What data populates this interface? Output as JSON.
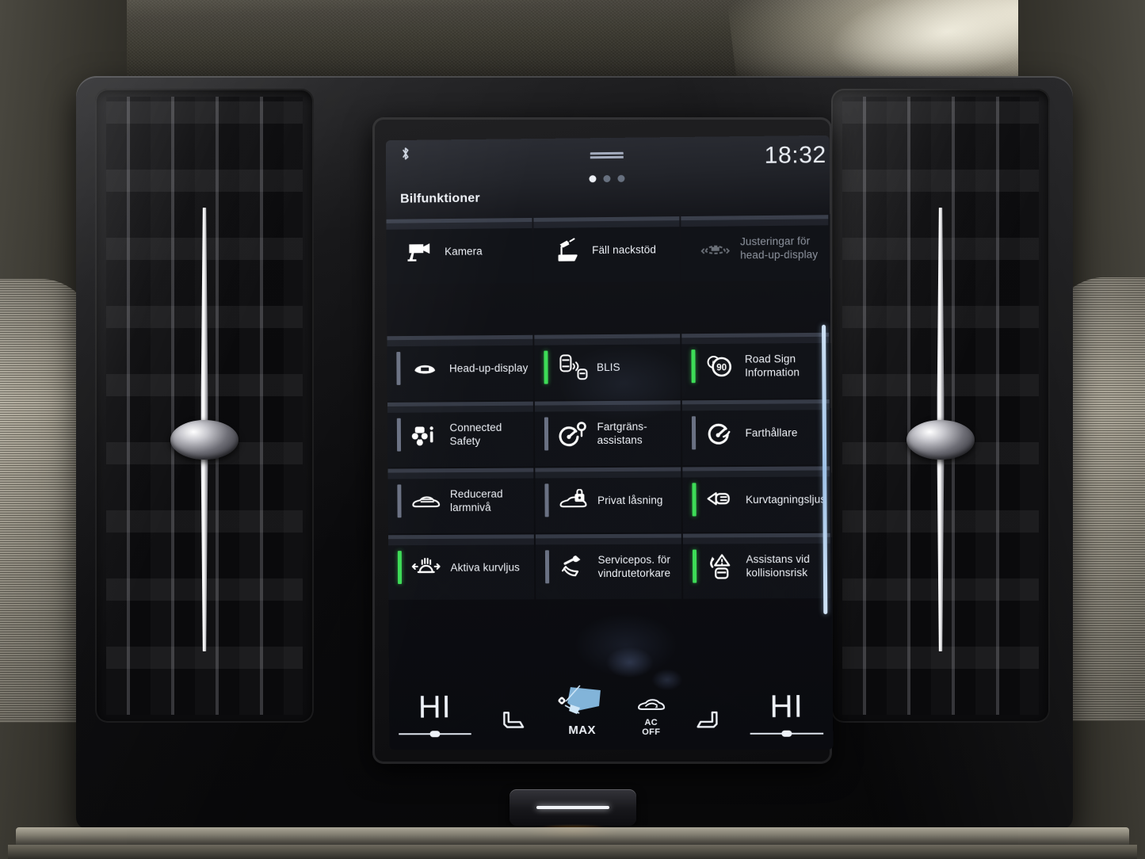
{
  "statusbar": {
    "bluetooth_icon": "bluetooth-icon",
    "time": "18:32",
    "page_dots": 3,
    "active_dot_index": 0
  },
  "page": {
    "title": "Bilfunktioner"
  },
  "colors": {
    "status_on": "#3ddc57",
    "status_off": "#6a7183",
    "scrollbar": "#bcd6ef",
    "text": "#eef1f7",
    "text_dim": "#8e949f",
    "climate_accent": "#7fb8e8"
  },
  "shortcut_row": [
    {
      "label": "Kamera",
      "icon": "camera-icon",
      "enabled": true,
      "has_status": false
    },
    {
      "label": "Fäll nackstöd",
      "icon": "fold-headrest-icon",
      "enabled": true,
      "has_status": false
    },
    {
      "label": "Justeringar för head-up-display",
      "icon": "head-up-display-adjust-icon",
      "enabled": false,
      "has_status": false
    }
  ],
  "function_tiles": [
    [
      {
        "label": "Head-up-display",
        "icon": "head-up-display-icon",
        "status": "off",
        "has_status": true
      },
      {
        "label": "BLIS",
        "icon": "blind-spot-icon",
        "status": "on",
        "has_status": true
      },
      {
        "label": "Road Sign Information",
        "icon": "road-sign-icon",
        "status": "on",
        "has_status": true
      }
    ],
    [
      {
        "label": "Connected Safety",
        "icon": "connected-safety-icon",
        "status": "off",
        "has_status": true
      },
      {
        "label": "Fartgräns-assistans",
        "icon": "speed-limiter-icon",
        "status": "off",
        "has_status": true
      },
      {
        "label": "Farthållare",
        "icon": "cruise-control-icon",
        "status": "off",
        "has_status": true
      }
    ],
    [
      {
        "label": "Reducerad larmnivå",
        "icon": "reduced-alarm-icon",
        "status": "off",
        "has_status": true
      },
      {
        "label": "Privat låsning",
        "icon": "private-locking-icon",
        "status": "off",
        "has_status": true
      },
      {
        "label": "Kurvtagningsljus",
        "icon": "cornering-light-icon",
        "status": "on",
        "has_status": true
      }
    ],
    [
      {
        "label": "Aktiva kurvljus",
        "icon": "active-bending-light-icon",
        "status": "on",
        "has_status": true
      },
      {
        "label": "Servicepos. för vindrutetorkare",
        "icon": "wiper-service-icon",
        "status": "off",
        "has_status": true
      },
      {
        "label": "Assistans vid kollisionsrisk",
        "icon": "collision-assist-icon",
        "status": "on",
        "has_status": true
      }
    ]
  ],
  "climate": {
    "left_temp": "HI",
    "left_seat_icon": "seat-heater-icon",
    "fan_icon": "fan-icon",
    "fan_label": "MAX",
    "ac_icon": "air-recirculation-icon",
    "ac_label_line1": "AC",
    "ac_label_line2": "OFF",
    "right_seat_icon": "seat-heater-icon",
    "right_temp": "HI"
  },
  "hardware": {
    "home_button": "home-button"
  }
}
